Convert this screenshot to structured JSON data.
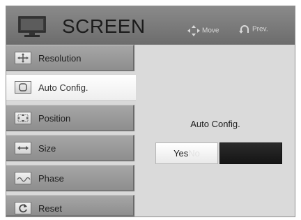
{
  "header": {
    "title": "SCREEN",
    "hint_move": "Move",
    "hint_prev": "Prev."
  },
  "sidebar": {
    "items": [
      {
        "label": "Resolution",
        "icon": "resolution-icon",
        "active": false
      },
      {
        "label": "Auto Config.",
        "icon": "auto-config-icon",
        "active": true
      },
      {
        "label": "Position",
        "icon": "position-icon",
        "active": false
      },
      {
        "label": "Size",
        "icon": "size-icon",
        "active": false
      },
      {
        "label": "Phase",
        "icon": "phase-icon",
        "active": false
      },
      {
        "label": "Reset",
        "icon": "reset-icon",
        "active": false
      }
    ]
  },
  "panel": {
    "title": "Auto Config.",
    "yes_label": "Yes",
    "no_label": "No"
  },
  "colors": {
    "header": "#7a7a7a",
    "sidebar_item": "#9a9a9a",
    "active_item": "#f7f7f7",
    "panel_bg": "#dadada",
    "dark_button": "#1f1f1f"
  }
}
